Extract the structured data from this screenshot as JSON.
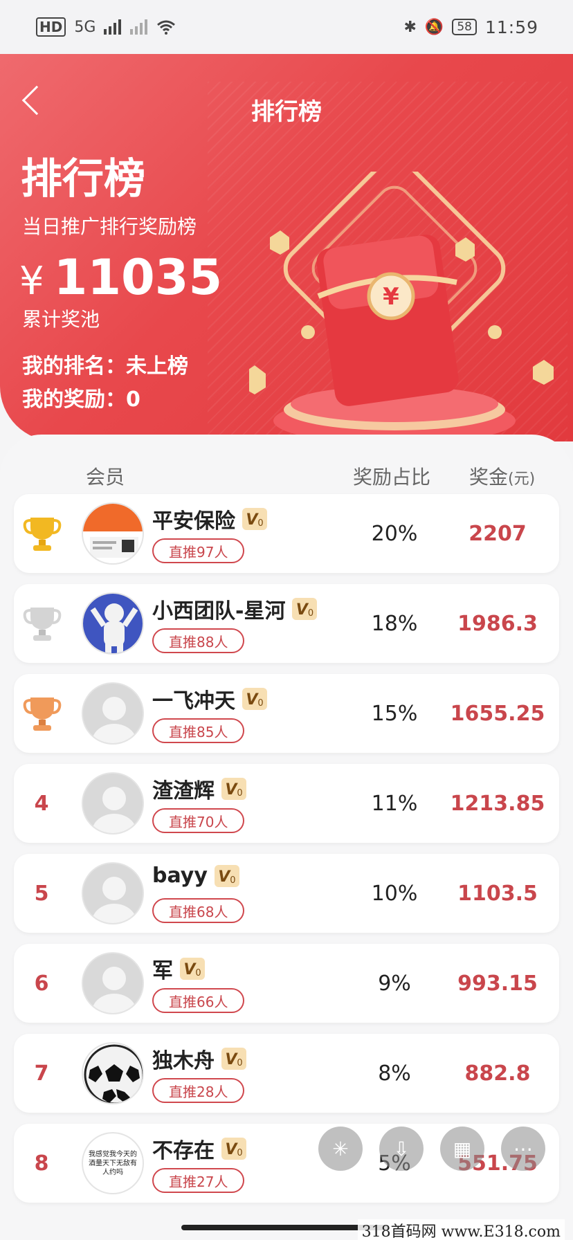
{
  "status_bar": {
    "hd_label": "HD",
    "network": "5G",
    "battery": "58",
    "time": "11:59"
  },
  "header": {
    "back_icon": "chevron-left-icon",
    "nav_title": "排行榜",
    "title": "排行榜",
    "subtitle": "当日推广排行奖励榜",
    "currency_symbol": "¥",
    "pool_amount": "11035",
    "pool_label": "累计奖池",
    "my_rank": "我的排名：未上榜",
    "my_reward": "我的奖励：0"
  },
  "columns": {
    "member": "会员",
    "ratio": "奖励占比",
    "amount": "奖金",
    "amount_unit": "(元)"
  },
  "colors": {
    "brand_red": "#e8484c",
    "amount_red": "#c9464c",
    "gold": "#f2b822",
    "silver": "#cfcfcf",
    "bronze": "#f09a5a"
  },
  "rows": [
    {
      "rank": "1",
      "trophy": "gold-trophy-icon",
      "name": "平安保险",
      "vip": "V",
      "vip_level": "0",
      "referral": "直推97人",
      "ratio": "20%",
      "amount": "2207",
      "avatar": "pingan-avatar"
    },
    {
      "rank": "2",
      "trophy": "silver-trophy-icon",
      "name": "小西团队-星河",
      "vip": "V",
      "vip_level": "0",
      "referral": "直推88人",
      "ratio": "18%",
      "amount": "1986.3",
      "avatar": "cartoon-avatar"
    },
    {
      "rank": "3",
      "trophy": "bronze-trophy-icon",
      "name": "一飞冲天",
      "vip": "V",
      "vip_level": "0",
      "referral": "直推85人",
      "ratio": "15%",
      "amount": "1655.25",
      "avatar": "default-avatar"
    },
    {
      "rank": "4",
      "name": "渣渣辉",
      "vip": "V",
      "vip_level": "0",
      "referral": "直推70人",
      "ratio": "11%",
      "amount": "1213.85",
      "avatar": "default-avatar"
    },
    {
      "rank": "5",
      "name": "bayy",
      "vip": "V",
      "vip_level": "0",
      "referral": "直推68人",
      "ratio": "10%",
      "amount": "1103.5",
      "avatar": "default-avatar"
    },
    {
      "rank": "6",
      "name": "军",
      "vip": "V",
      "vip_level": "0",
      "referral": "直推66人",
      "ratio": "9%",
      "amount": "993.15",
      "avatar": "default-avatar"
    },
    {
      "rank": "7",
      "name": "独木舟",
      "vip": "V",
      "vip_level": "0",
      "referral": "直推28人",
      "ratio": "8%",
      "amount": "882.8",
      "avatar": "soccer-ball-avatar"
    },
    {
      "rank": "8",
      "name": "不存在",
      "vip": "V",
      "vip_level": "0",
      "referral": "直推27人",
      "ratio": "5%",
      "amount": "551.75",
      "avatar": "text-avatar",
      "avatar_text": "我感觉我今天的酒量天下无敌有人约吗"
    }
  ],
  "fabs": [
    "spark-icon",
    "download-icon",
    "grid-icon",
    "more-icon"
  ],
  "watermark": "318首码网  www.E318.com"
}
